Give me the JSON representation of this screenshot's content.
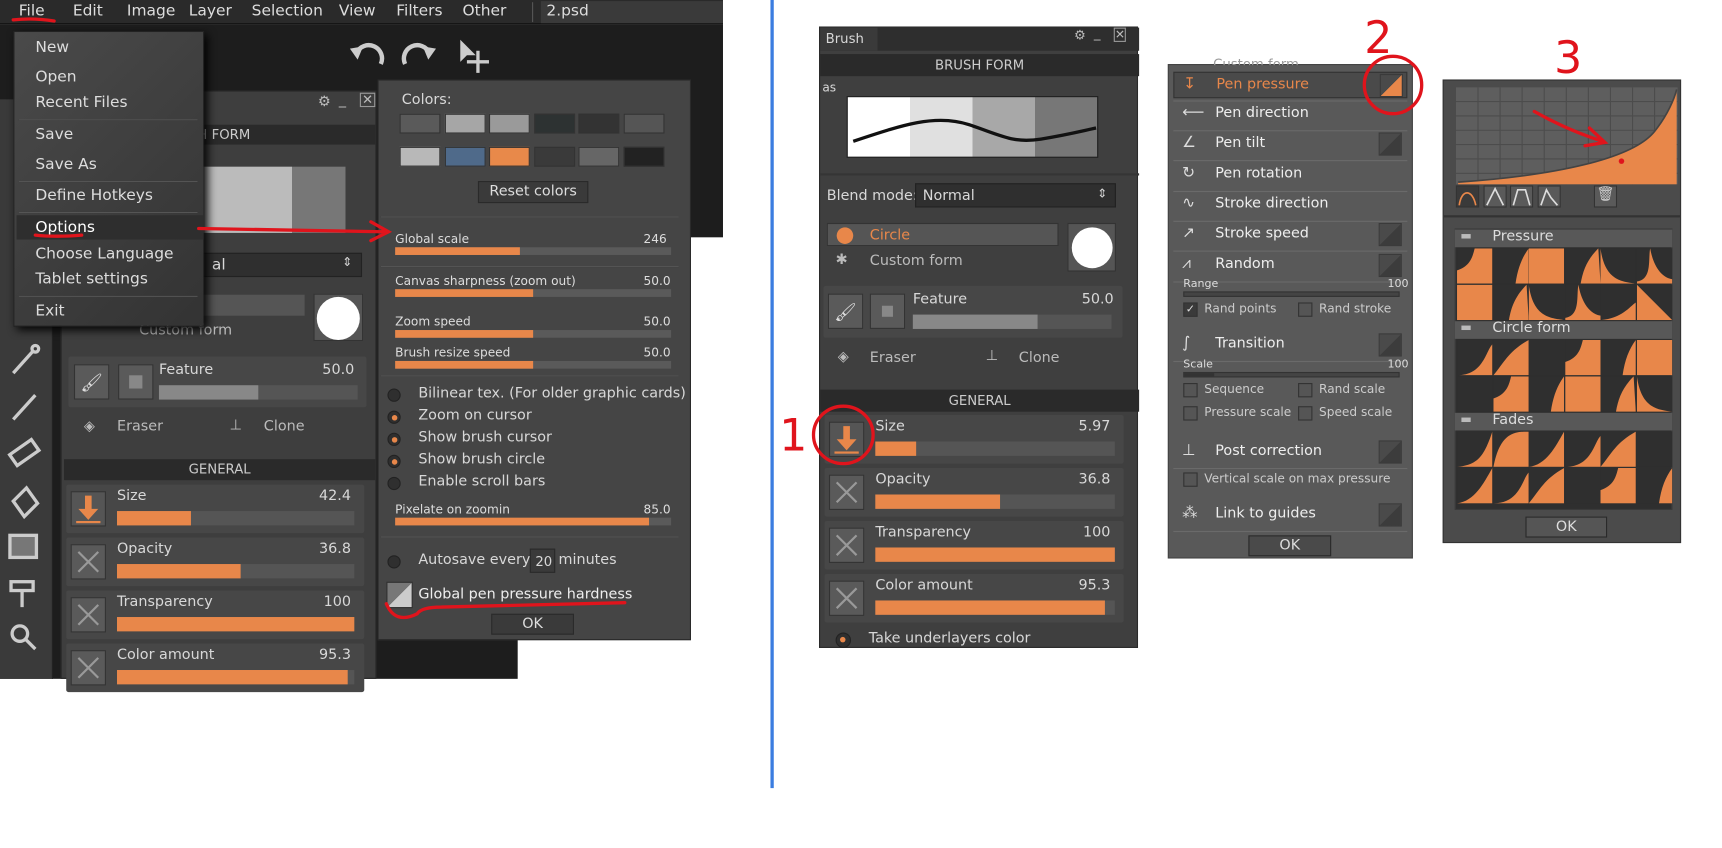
{
  "menubar": {
    "items": [
      "File",
      "Edit",
      "Image",
      "Layer",
      "Selection",
      "View",
      "Filters",
      "Other"
    ],
    "document": "2.psd"
  },
  "file_menu": {
    "items": [
      "New",
      "Open",
      "Recent Files",
      "Save",
      "Save As",
      "Define Hotkeys",
      "Options",
      "Choose Language",
      "Tablet settings",
      "Exit"
    ],
    "selected": "Options"
  },
  "left_brush_panel": {
    "section": "SH FORM",
    "blend_partial": "al",
    "custom_form": "Custom form",
    "feature": {
      "label": "Feature",
      "value": "50.0",
      "level": 0.5
    },
    "eraser": "Eraser",
    "clone": "Clone",
    "general": "GENERAL",
    "sliders": [
      {
        "label": "Size",
        "value": "42.4",
        "level": 0.31
      },
      {
        "label": "Opacity",
        "value": "36.8",
        "level": 0.52
      },
      {
        "label": "Transparency",
        "value": "100",
        "level": 1.0
      },
      {
        "label": "Color amount",
        "value": "95.3",
        "level": 0.97
      }
    ]
  },
  "options_dialog": {
    "colors_label": "Colors:",
    "swatches": [
      "#5a5a5a",
      "#a6a6a6",
      "#9a9a9a",
      "#2d3232",
      "#333333",
      "#555555",
      "#b8b8b8",
      "#4f6a8a",
      "#e8894a",
      "#3a3a3a",
      "#666666",
      "#222222"
    ],
    "reset_colors": "Reset colors",
    "sliders": [
      {
        "label": "Global scale",
        "value": "246",
        "level": 0.45
      },
      {
        "label": "Canvas sharpness (zoom out)",
        "value": "50.0",
        "level": 0.5
      },
      {
        "label": "Zoom speed",
        "value": "50.0",
        "level": 0.5
      },
      {
        "label": "Brush resize speed",
        "value": "50.0",
        "level": 0.5
      },
      {
        "label": "Pixelate on zoomin",
        "value": "85.0",
        "level": 0.92
      }
    ],
    "radios": [
      {
        "label": "Bilinear tex. (For older graphic cards)",
        "on": false
      },
      {
        "label": "Zoom on cursor",
        "on": true
      },
      {
        "label": "Show brush cursor",
        "on": true
      },
      {
        "label": "Show brush circle",
        "on": true
      },
      {
        "label": "Enable scroll bars",
        "on": false
      }
    ],
    "autosave_label": "Autosave every",
    "autosave_value": "20",
    "autosave_unit": "minutes",
    "pen_hardness": "Global pen pressure hardness",
    "ok": "OK"
  },
  "brush_panel": {
    "tab": "Brush",
    "section": "BRUSH FORM",
    "preset_partial": "as",
    "blend_label": "Blend mode:",
    "blend_value": "Normal",
    "circle": "Circle",
    "custom_form": "Custom form",
    "feature": {
      "label": "Feature",
      "value": "50.0",
      "level": 0.63
    },
    "eraser": "Eraser",
    "clone": "Clone",
    "general": "GENERAL",
    "sliders": [
      {
        "label": "Size",
        "value": "5.97",
        "level": 0.17
      },
      {
        "label": "Opacity",
        "value": "36.8",
        "level": 0.52
      },
      {
        "label": "Transparency",
        "value": "100",
        "level": 1.0
      },
      {
        "label": "Color amount",
        "value": "95.3",
        "level": 0.96
      }
    ],
    "underlayers": "Take underlayers color"
  },
  "pen_panel": {
    "header_partial": "Custom form",
    "rows": [
      "Pen pressure",
      "Pen direction",
      "Pen tilt",
      "Pen rotation",
      "Stroke direction",
      "Stroke speed",
      "Random",
      "Transition",
      "Post correction",
      "Link to guides"
    ],
    "range_label": "Range",
    "range_value": "100",
    "rand_points": "Rand points",
    "rand_stroke": "Rand stroke",
    "scale_label": "Scale",
    "scale_value": "100",
    "sequence": "Sequence",
    "rand_scale": "Rand scale",
    "pressure_scale": "Pressure scale",
    "speed_scale": "Speed scale",
    "vertical_scale": "Vertical scale on max pressure",
    "ok": "OK"
  },
  "curve_panel": {
    "groups": [
      "Pressure",
      "Circle form",
      "Fades"
    ],
    "ok": "OK"
  },
  "annotations": {
    "n1": "1",
    "n2": "2",
    "n3": "3"
  },
  "colors": {
    "accent": "#e8874a",
    "annotation": "#e0141c",
    "divider": "#3b7de0"
  }
}
